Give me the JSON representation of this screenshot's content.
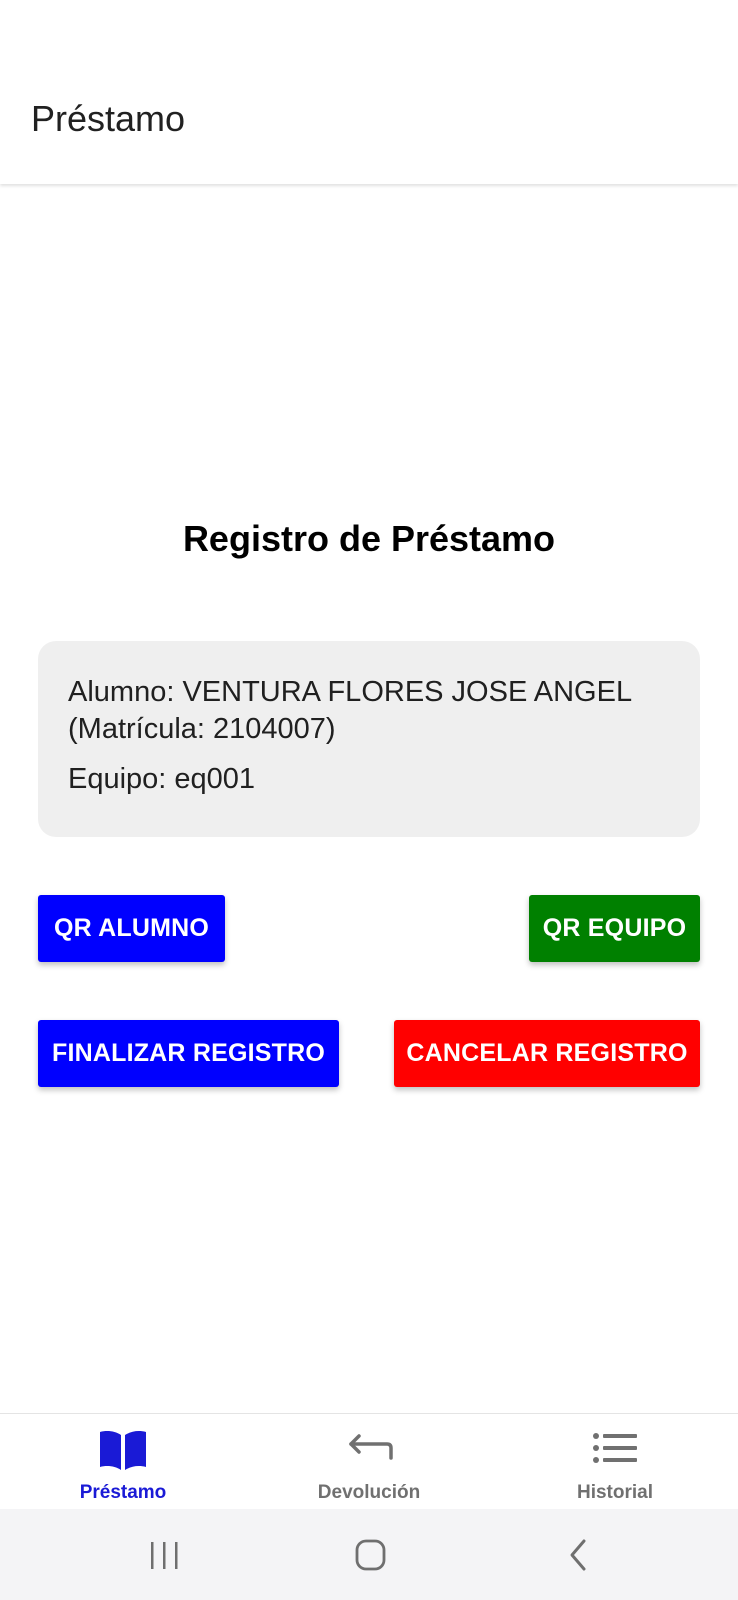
{
  "app_bar": {
    "title": "Préstamo"
  },
  "main": {
    "section_title": "Registro de Préstamo",
    "info": {
      "student": "Alumno: VENTURA FLORES JOSE ANGEL (Matrícula: 2104007)",
      "equipment": "Equipo: eq001"
    },
    "buttons": {
      "qr_alumno": "QR ALUMNO",
      "qr_equipo": "QR EQUIPO",
      "finalizar": "FINALIZAR REGISTRO",
      "cancelar": "CANCELAR REGISTRO"
    }
  },
  "bottom_nav": {
    "items": [
      {
        "label": "Préstamo",
        "icon": "book-open-icon",
        "active": true
      },
      {
        "label": "Devolución",
        "icon": "return-arrow-icon",
        "active": false
      },
      {
        "label": "Historial",
        "icon": "list-icon",
        "active": false
      }
    ]
  },
  "system_nav": {
    "buttons": [
      "recents-icon",
      "home-icon",
      "back-icon"
    ]
  },
  "colors": {
    "primary_blue": "#0000ff",
    "green": "#008000",
    "red": "#ff0000",
    "nav_active": "#1a1ad6",
    "nav_inactive": "#707070",
    "card_bg": "#efefef"
  }
}
